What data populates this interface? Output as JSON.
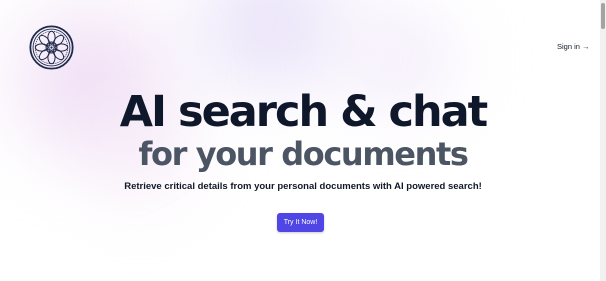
{
  "header": {
    "logo_icon": "mandala-logo-icon",
    "signin_label": "Sign in →"
  },
  "hero": {
    "title": "AI search & chat",
    "subtitle": "for your documents",
    "tagline": "Retrieve critical details from your personal documents with AI powered search!",
    "cta_label": "Try It Now!"
  },
  "colors": {
    "accent": "#4f46e5",
    "title": "#0f172a",
    "subtitle": "#4b5563",
    "logo": "#1e2a4a"
  }
}
